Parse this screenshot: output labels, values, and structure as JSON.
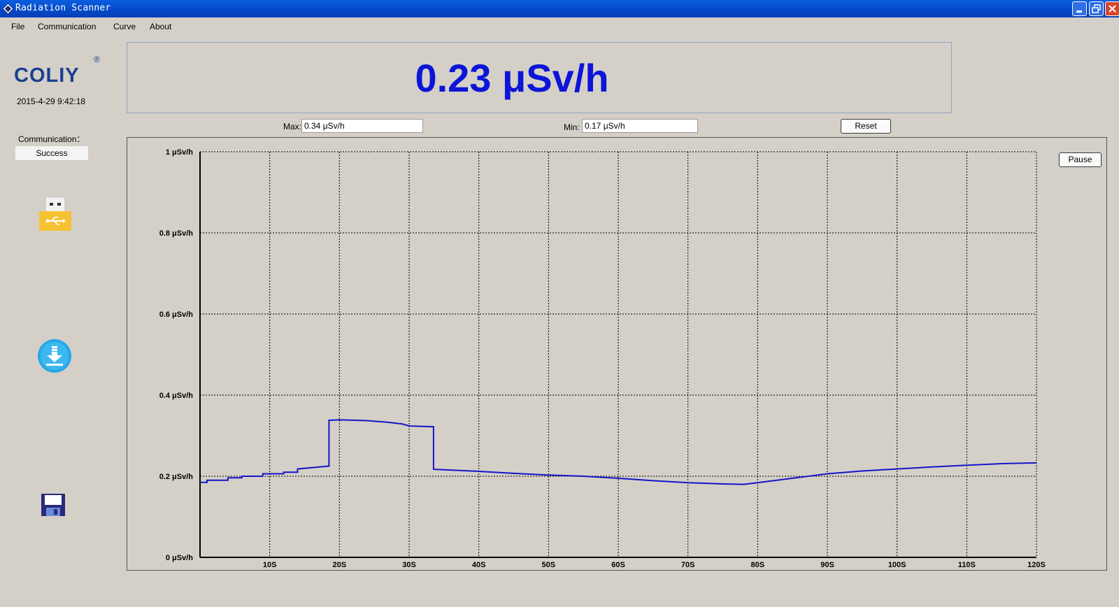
{
  "window": {
    "title": "Radiation Scanner",
    "title_bar_color": "#0a4fd4"
  },
  "menu": [
    "File",
    "Communication",
    "Curve",
    "About"
  ],
  "sidebar": {
    "logo": "COLIY",
    "logo_mark": "®",
    "datetime": "2015-4-29 9:42:18",
    "communication_label": "Communication：",
    "communication_status": "Success",
    "icons": [
      "usb-icon",
      "download-icon",
      "save-icon"
    ]
  },
  "reading": {
    "value": "0.23 μSv/h",
    "color": "#0c15d8"
  },
  "stats": {
    "max_label": "Max:",
    "max_value": "0.34 μSv/h",
    "min_label": "Min:",
    "min_value": "0.17 μSv/h",
    "reset_label": "Reset"
  },
  "chart_controls": {
    "pause_label": "Pause"
  },
  "chart_data": {
    "type": "line",
    "title": "",
    "xlabel": "",
    "ylabel": "",
    "xlim": [
      0,
      120
    ],
    "ylim": [
      0,
      1
    ],
    "x_ticks": [
      "10S",
      "20S",
      "30S",
      "40S",
      "50S",
      "60S",
      "70S",
      "80S",
      "90S",
      "100S",
      "110S",
      "120S"
    ],
    "y_ticks": [
      "0 μSv/h",
      "0.2 μSv/h",
      "0.4 μSv/h",
      "0.6 μSv/h",
      "0.8 μSv/h",
      "1 μSv/h"
    ],
    "grid": true,
    "line_color": "#1515c8",
    "series": [
      {
        "x": [
          0,
          1,
          1,
          4,
          4,
          6,
          6,
          9,
          9,
          12,
          12,
          14,
          14,
          18.5,
          18.5,
          20,
          24,
          27,
          29,
          30,
          33.5,
          33.5,
          35,
          40,
          45,
          50,
          55,
          60,
          65,
          70,
          75,
          78,
          80,
          85,
          90,
          95,
          100,
          105,
          110,
          115,
          120
        ],
        "y": [
          0.185,
          0.185,
          0.19,
          0.19,
          0.196,
          0.196,
          0.2,
          0.2,
          0.206,
          0.206,
          0.21,
          0.21,
          0.218,
          0.225,
          0.338,
          0.339,
          0.337,
          0.333,
          0.329,
          0.324,
          0.322,
          0.217,
          0.216,
          0.212,
          0.207,
          0.203,
          0.2,
          0.195,
          0.189,
          0.184,
          0.181,
          0.18,
          0.184,
          0.195,
          0.206,
          0.213,
          0.218,
          0.223,
          0.227,
          0.231,
          0.233
        ]
      }
    ]
  }
}
